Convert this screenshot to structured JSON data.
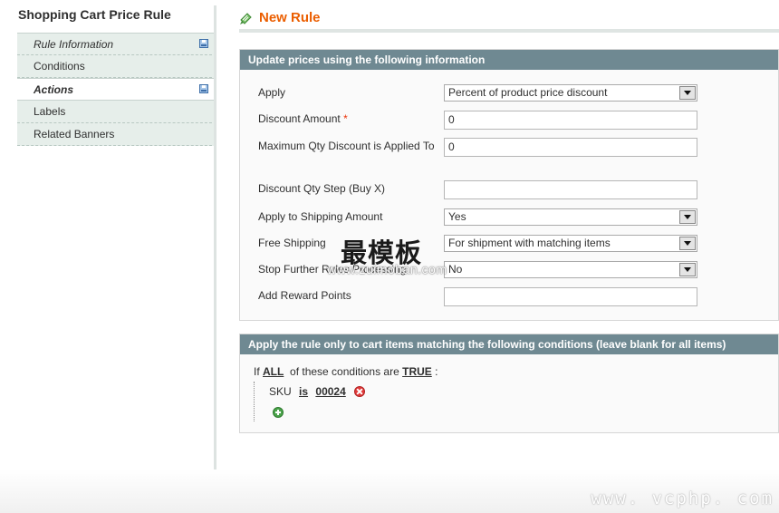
{
  "sidebar": {
    "title": "Shopping Cart Price Rule",
    "items": [
      {
        "label": "Rule Information"
      },
      {
        "label": "Conditions"
      },
      {
        "label": "Actions"
      },
      {
        "label": "Labels"
      },
      {
        "label": "Related Banners"
      }
    ]
  },
  "header": {
    "title": "New Rule",
    "icon": "rule-icon"
  },
  "actions_box": {
    "heading": "Update prices using the following information",
    "fields": {
      "apply": {
        "label": "Apply",
        "value": "Percent of product price discount"
      },
      "discount_amount": {
        "label": "Discount Amount",
        "required": "*",
        "value": "0"
      },
      "max_qty": {
        "label": "Maximum Qty Discount is Applied To",
        "value": "0"
      },
      "qty_step": {
        "label": "Discount Qty Step (Buy X)",
        "value": ""
      },
      "apply_shipping": {
        "label": "Apply to Shipping Amount",
        "value": "Yes"
      },
      "free_shipping": {
        "label": "Free Shipping",
        "value": "For shipment with matching items"
      },
      "stop_further": {
        "label": "Stop Further Rules Processing",
        "value": "No"
      },
      "reward_points": {
        "label": "Add Reward Points",
        "value": ""
      }
    }
  },
  "conditions_box": {
    "heading": "Apply the rule only to cart items matching the following conditions (leave blank for all items)",
    "if_text": "If",
    "aggregator": "ALL",
    "middle_text": "of these conditions are",
    "value": "TRUE",
    "colon": ":",
    "condition": {
      "attribute": "SKU",
      "operator": "is",
      "value": "00024"
    }
  },
  "watermarks": {
    "cn": "最模板",
    "site": "www.zuimoban.com",
    "footer": "www. vcphp. com"
  },
  "colors": {
    "accent": "#eb5e00",
    "header_bar": "#6f8992",
    "sidebar_bg": "#e6eeea"
  }
}
